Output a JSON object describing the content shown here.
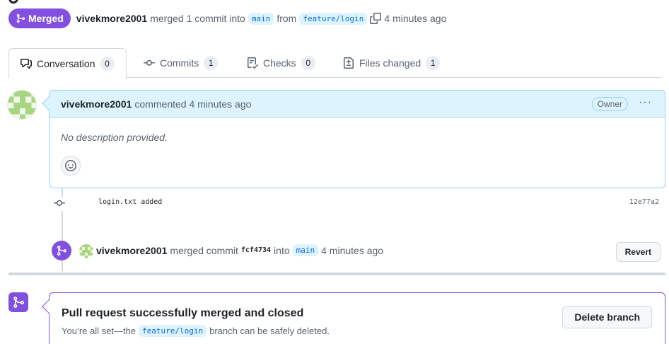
{
  "header": {
    "state": "Merged",
    "author": "vivekmore2001",
    "action_text": "merged 1 commit into",
    "base_branch": "main",
    "from_text": "from",
    "head_branch": "feature/login",
    "time_ago": "4 minutes ago"
  },
  "tabs": [
    {
      "label": "Conversation",
      "count": "0",
      "icon": "conversation-icon",
      "active": true
    },
    {
      "label": "Commits",
      "count": "1",
      "icon": "commit-icon"
    },
    {
      "label": "Checks",
      "count": "0",
      "icon": "checklist-icon"
    },
    {
      "label": "Files changed",
      "count": "1",
      "icon": "file-diff-icon"
    }
  ],
  "comment": {
    "author": "vivekmore2001",
    "action": "commented 4 minutes ago",
    "role_badge": "Owner",
    "more_label": "···",
    "body": "No description provided."
  },
  "commit": {
    "message": "login.txt added",
    "sha": "12e77a2"
  },
  "merge_event": {
    "author": "vivekmore2001",
    "action": "merged commit",
    "sha": "fcf4734",
    "into_text": "into",
    "branch": "main",
    "time_ago": "4 minutes ago",
    "revert_label": "Revert"
  },
  "merge_status": {
    "title": "Pull request successfully merged and closed",
    "sub_prefix": "You’re all set—the",
    "branch": "feature/login",
    "sub_suffix": "branch can be safely deleted.",
    "delete_label": "Delete branch"
  },
  "colors": {
    "merged_purple": "#8250df",
    "comment_blue": "#ddf4ff",
    "border": "#d1d9e0"
  }
}
